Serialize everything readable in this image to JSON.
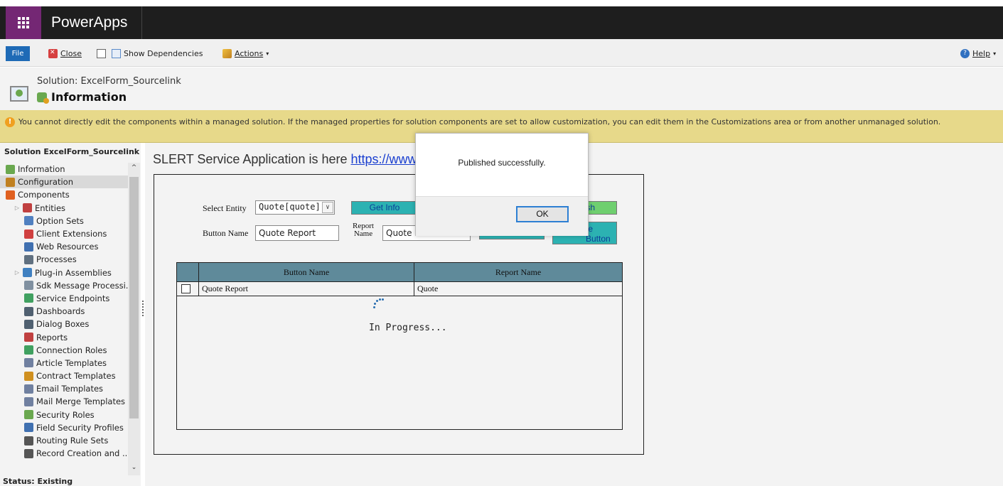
{
  "app": {
    "title": "PowerApps"
  },
  "ribbon": {
    "file_label": "File",
    "close_label": "Close",
    "show_dependencies_label": "Show Dependencies",
    "actions_label": "Actions",
    "help_label": "Help"
  },
  "header": {
    "solution_label": "Solution: ExcelForm_Sourcelink",
    "page_title": "Information"
  },
  "warning": {
    "text": "You cannot directly edit the components within a managed solution. If the managed properties for solution components are set to allow customization, you can edit them in the Customizations area or from another unmanaged solution."
  },
  "sidebar": {
    "title": "Solution ExcelForm_Sourcelink",
    "items": [
      {
        "label": "Information",
        "icon": "gear-puzzle-icon",
        "color": "#6aa84f"
      },
      {
        "label": "Configuration",
        "icon": "configuration-icon",
        "color": "#c08020"
      },
      {
        "label": "Components",
        "icon": "components-icon",
        "color": "#e06020"
      },
      {
        "label": "Entities",
        "icon": "entities-icon",
        "color": "#c04040"
      },
      {
        "label": "Option Sets",
        "icon": "option-sets-icon",
        "color": "#5080c0"
      },
      {
        "label": "Client Extensions",
        "icon": "client-extensions-icon",
        "color": "#d04040"
      },
      {
        "label": "Web Resources",
        "icon": "web-resources-icon",
        "color": "#4070b0"
      },
      {
        "label": "Processes",
        "icon": "processes-icon",
        "color": "#607080"
      },
      {
        "label": "Plug-in Assemblies",
        "icon": "plugin-icon",
        "color": "#4080c0"
      },
      {
        "label": "Sdk Message Processi...",
        "icon": "sdk-icon",
        "color": "#8090a0"
      },
      {
        "label": "Service Endpoints",
        "icon": "service-endpoints-icon",
        "color": "#40a060"
      },
      {
        "label": "Dashboards",
        "icon": "dashboards-icon",
        "color": "#506070"
      },
      {
        "label": "Dialog Boxes",
        "icon": "dialog-boxes-icon",
        "color": "#506070"
      },
      {
        "label": "Reports",
        "icon": "reports-icon",
        "color": "#c04040"
      },
      {
        "label": "Connection Roles",
        "icon": "connection-roles-icon",
        "color": "#40a060"
      },
      {
        "label": "Article Templates",
        "icon": "article-templates-icon",
        "color": "#7080a0"
      },
      {
        "label": "Contract Templates",
        "icon": "contract-templates-icon",
        "color": "#d09020"
      },
      {
        "label": "Email Templates",
        "icon": "email-templates-icon",
        "color": "#7080a0"
      },
      {
        "label": "Mail Merge Templates",
        "icon": "mail-merge-icon",
        "color": "#7080a0"
      },
      {
        "label": "Security Roles",
        "icon": "security-roles-icon",
        "color": "#6aa84f"
      },
      {
        "label": "Field Security Profiles",
        "icon": "field-security-icon",
        "color": "#4070b0"
      },
      {
        "label": "Routing Rule Sets",
        "icon": "routing-icon",
        "color": "#555555"
      },
      {
        "label": "Record Creation and ...",
        "icon": "record-creation-icon",
        "color": "#555555"
      }
    ],
    "status": "Status: Existing"
  },
  "main": {
    "service_text": "SLERT Service Application is here ",
    "service_link": "https://www",
    "select_entity_label": "Select Entity",
    "select_entity_value": "Quote[quote]",
    "get_info_label": "Get Info",
    "publish_label": "sh",
    "button_name_label": "Button Name",
    "button_name_value": "Quote Report",
    "report_name_label": "Report Name",
    "report_name_value": "Quote",
    "create_button_label": "te Button",
    "grid": {
      "columns": [
        "Button Name",
        "Report Name"
      ],
      "rows": [
        {
          "button_name": "Quote Report",
          "report_name": "Quote"
        }
      ]
    },
    "progress_text": "In Progress..."
  },
  "modal": {
    "message": "Published successfully.",
    "ok_label": "OK"
  }
}
